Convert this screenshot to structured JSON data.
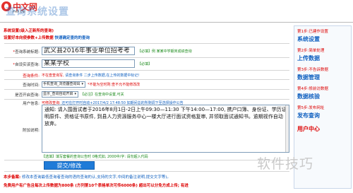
{
  "brand": {
    "name_cn": "中文网",
    "name_en": "PHP.CN"
  },
  "page": {
    "title": "查询系统设置"
  },
  "warnings": {
    "line1": "系统设置(级入正新所的查询)",
    "line2_red": "设置好本向使参数+上传数据",
    "line2_blue": "快速确定查的的查询"
  },
  "form": {
    "query_name": {
      "label": "查询系统标题:",
      "value": "武义县2016年事业单位招考考",
      "hint": "【必填】例 某某中学期末成绩查询"
    },
    "owner": {
      "label": "自设实该查询:",
      "value": "某某学校",
      "hint": "【必填】"
    },
    "notice": {
      "label": "查询条件:",
      "text_red": "不在查查询写,",
      "text_blue": "请查询条件 二步上传数据,在上传的数据中标记!"
    },
    "duration": {
      "label": "查询时间:",
      "select": "手机查询_浏览器查询出",
      "hint_red": "*不能为空时则:查不允不能修改改"
    },
    "status": {
      "label": "是否开启查询:",
      "select": "显示_查询自动开启",
      "hint_green": "【必注】在查询中设置,可关"
    },
    "extra": {
      "label": "用户信息:",
      "hint_red": "可修改查询:",
      "hint_blue": "还可在打开时自动+2017/4/2 17:48:50 如期间总的所剩调下至选择操作公告"
    },
    "content": {
      "label": "附加说明:",
      "text": "通知: 请入围面试者于2016年8月1日-2日上午09:30—11:30 下午14:00—17:00, 携户口簿、身份证、学历证明原件、资格证书原件, 到县人力资源服务中心一楼大厅进行面试资格复审, 并领取面试通知书。逾期视作自动放弃。"
    },
    "content_hint": "【选填】填写套餐的查询公告时   0格式如, 2000中/字: 请勿超入代码"
  },
  "submit": {
    "label": "提交/修改"
  },
  "footer": {
    "line1_red": "本步备案:",
    "line1_rest": "修改本查询最低查询者查询的语的查询的认,支持的文字,中间的备注说明,提交文字等)。",
    "line2": "免费用户有广告且每次上传数据为800条 (方列第10个表格单次可传6000条) 超出可以分免方成上传; 有进"
  },
  "sidebar": {
    "steps": [
      {
        "small": "第1步:已建作设置",
        "big": "系统设置"
      },
      {
        "small": "第2步:简单处理",
        "big": "上传数据"
      },
      {
        "small": "第3步:不告诉数据",
        "big": "数据管理"
      },
      {
        "small": "第4步:修前访数据",
        "big": "数据核验"
      },
      {
        "small": "第5步:发布网址",
        "big": "发布查询"
      },
      {
        "small": "",
        "big": "用户中心"
      }
    ]
  },
  "watermark": {
    "text": "软件技巧"
  }
}
